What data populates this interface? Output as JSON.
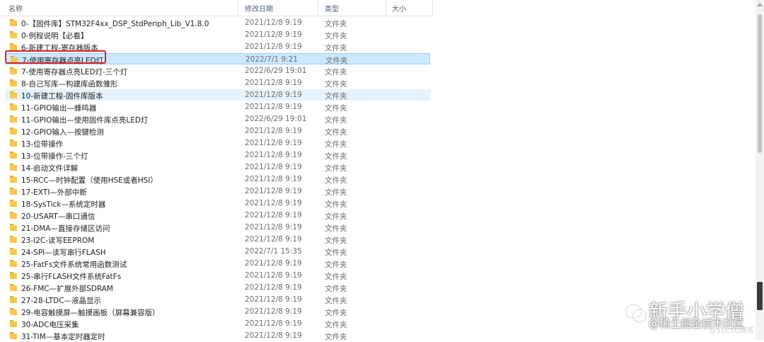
{
  "header": {
    "name": "名称",
    "date": "修改日期",
    "type": "类型",
    "size": "大小"
  },
  "rows": [
    {
      "name": "0-【固件库】STM32F4xx_DSP_StdPeriph_Lib_V1.8.0",
      "date": "2021/12/8 9:19",
      "type": "文件夹"
    },
    {
      "name": "0-例程说明【必看】",
      "date": "2021/12/8 9:19",
      "type": "文件夹"
    },
    {
      "name": "6-新建工程-寄存器版本",
      "date": "2021/12/8 9:19",
      "type": "文件夹"
    },
    {
      "name": "7-使用寄存器点亮LED灯",
      "date": "2022/7/1 9:21",
      "type": "文件夹"
    },
    {
      "name": "7-使用寄存器点亮LED灯-三个灯",
      "date": "2022/6/29 19:01",
      "type": "文件夹"
    },
    {
      "name": "8-自己写库—构建库函数雏形",
      "date": "2021/12/8 9:19",
      "type": "文件夹"
    },
    {
      "name": "10-新建工程-固件库版本",
      "date": "2021/12/8 9:19",
      "type": "文件夹"
    },
    {
      "name": "11-GPIO输出—蜂鸣器",
      "date": "2021/12/8 9:19",
      "type": "文件夹"
    },
    {
      "name": "11-GPIO输出—使用固件库点亮LED灯",
      "date": "2022/6/29 19:01",
      "type": "文件夹"
    },
    {
      "name": "12-GPIO输入—按键检测",
      "date": "2021/12/8 9:19",
      "type": "文件夹"
    },
    {
      "name": "13-位带操作",
      "date": "2021/12/8 9:19",
      "type": "文件夹"
    },
    {
      "name": "13-位带操作-三个灯",
      "date": "2021/12/8 9:19",
      "type": "文件夹"
    },
    {
      "name": "14-启动文件详解",
      "date": "2021/12/8 9:19",
      "type": "文件夹"
    },
    {
      "name": "15-RCC—时钟配置（使用HSE或者HSI）",
      "date": "2021/12/8 9:19",
      "type": "文件夹"
    },
    {
      "name": "17-EXTI—外部中断",
      "date": "2021/12/8 9:19",
      "type": "文件夹"
    },
    {
      "name": "18-SysTick—系统定时器",
      "date": "2021/12/8 9:19",
      "type": "文件夹"
    },
    {
      "name": "20-USART—串口通信",
      "date": "2021/12/8 9:19",
      "type": "文件夹"
    },
    {
      "name": "21-DMA—直接存储区访问",
      "date": "2021/12/8 9:19",
      "type": "文件夹"
    },
    {
      "name": "23-I2C-读写EEPROM",
      "date": "2021/12/8 9:19",
      "type": "文件夹"
    },
    {
      "name": "24-SPI—读写串行FLASH",
      "date": "2022/7/1 15:35",
      "type": "文件夹"
    },
    {
      "name": "25-FatFs文件系统常用函数测试",
      "date": "2021/12/8 9:19",
      "type": "文件夹"
    },
    {
      "name": "25-串行FLASH文件系统FatFs",
      "date": "2021/12/8 9:19",
      "type": "文件夹"
    },
    {
      "name": "26-FMC—扩展外部SDRAM",
      "date": "2021/12/8 9:19",
      "type": "文件夹"
    },
    {
      "name": "27-28-LTDC—液晶显示",
      "date": "2021/12/8 9:19",
      "type": "文件夹"
    },
    {
      "name": "29-电容触摸屏—触摸画板（屏幕兼容版）",
      "date": "2021/12/8 9:19",
      "type": "文件夹"
    },
    {
      "name": "30-ADC电压采集",
      "date": "2021/12/8 9:19",
      "type": "文件夹"
    },
    {
      "name": "31-TIM—基本定时器定时",
      "date": "2021/12/8 9:19",
      "type": "文件夹"
    }
  ],
  "selected_index": 3,
  "hover_index": 6,
  "watermark": {
    "main": "新手小学僧",
    "sub": "@稀土掘金技术社区",
    "corner": "@51CTO博客"
  },
  "colors": {
    "selected_bg": "#cce8ff",
    "highlight_box": "#e02020",
    "folder": "#f4c94f"
  }
}
